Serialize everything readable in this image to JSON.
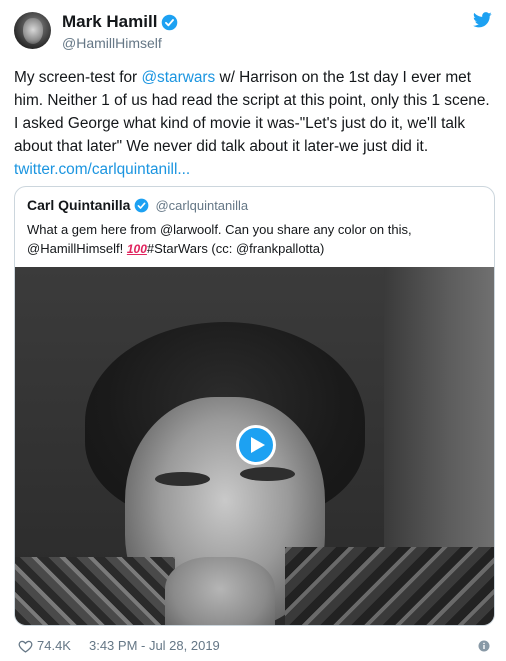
{
  "author": {
    "display_name": "Mark Hamill",
    "handle": "@HamillHimself"
  },
  "tweet": {
    "text_part1": "My screen-test for ",
    "mention": "@starwars",
    "text_part2": " w/ Harrison on the 1st day I ever met him. Neither 1 of us had read the script at this point, only this 1 scene. I asked George what kind of movie it was-\"Let's just do it, we'll talk about that later\" We never did talk about it later-we just did it.",
    "link": "twitter.com/carlquintanill..."
  },
  "quoted_tweet": {
    "display_name": "Carl Quintanilla",
    "handle": "@carlquintanilla",
    "text_line1": "What a gem here from @larwoolf. Can you share any color on this,",
    "text_line2_a": "@HamillHimself! ",
    "emoji_100": "100",
    "text_line2_b": "#StarWars (cc: @frankpallotta)"
  },
  "footer": {
    "likes": "74.4K",
    "timestamp": "3:43 PM - Jul 28, 2019"
  },
  "colors": {
    "accent": "#1da1f2",
    "link": "#1b95e0",
    "secondary_text": "#657786",
    "border": "#ccd6dd"
  },
  "icons": [
    "verified-icon",
    "twitter-bird-icon",
    "play-icon",
    "heart-icon",
    "info-icon"
  ]
}
